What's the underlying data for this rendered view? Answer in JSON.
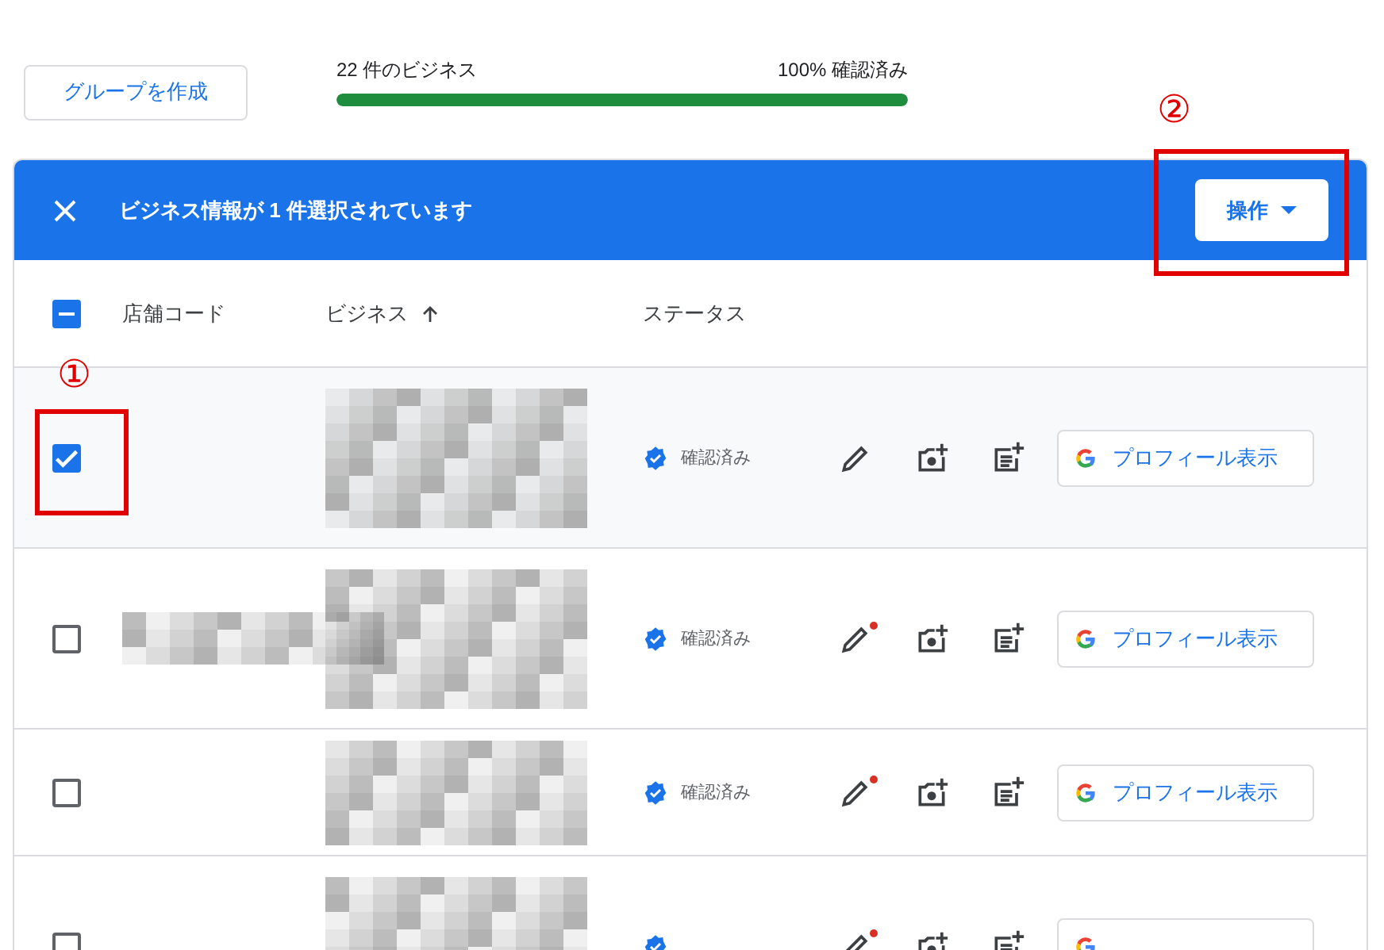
{
  "toolbar": {
    "create_group_button": "グループを作成",
    "business_count": "22 件のビジネス",
    "verified_share": "100% 確認済み",
    "verified_progress": {
      "level": 1
    }
  },
  "selection_bar": {
    "message": "ビジネス情報が 1 件選択されています",
    "actions_button": "操作"
  },
  "table": {
    "select_all": {
      "indeterminate": true
    },
    "columns": [
      {
        "label": "店舗コード",
        "sorted": false
      },
      {
        "label": "ビジネス",
        "sorted": true
      },
      {
        "label": "ステータス",
        "sorted": false
      }
    ],
    "rows": [
      {
        "selected": true,
        "store_code_blurred": false,
        "status": "確認済み",
        "edit_alert": false,
        "profile_button": "プロフィール表示"
      },
      {
        "selected": false,
        "store_code_blurred": true,
        "status": "確認済み",
        "edit_alert": true,
        "profile_button": "プロフィール表示"
      },
      {
        "selected": false,
        "store_code_blurred": false,
        "status": "確認済み",
        "edit_alert": true,
        "profile_button": "プロフィール表示"
      },
      {
        "selected": false,
        "store_code_blurred": false,
        "edit_alert": true
      }
    ]
  },
  "annotations": [
    {
      "label": "①"
    },
    {
      "label": "②"
    }
  ]
}
